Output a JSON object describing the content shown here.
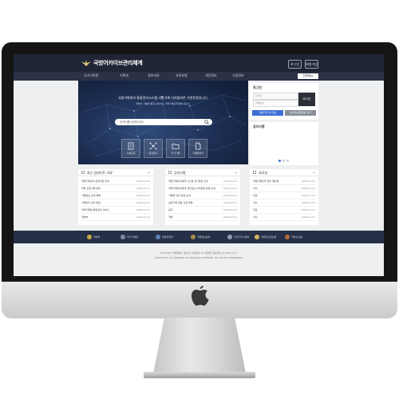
{
  "header": {
    "site_title": "국방어카이브관리체계",
    "buttons": [
      "로그인",
      "회원가입"
    ]
  },
  "nav": {
    "items": [
      "국가기록원",
      "기록관",
      "정보자료",
      "자료유형",
      "개인정보",
      "기관정보"
    ],
    "button_label": "전체메뉴"
  },
  "hero": {
    "headline": "국방기록관리 통합관리시스템 국방기록 디지털보존 기관운영입니다.",
    "subline": "국방부 기록을 통합 관리하는 국방기록관리체계 입니다.",
    "search_placeholder": "검색어를 입력하세요",
    "quick_links": [
      {
        "label": "기록조회",
        "icon": "document-icon"
      },
      {
        "label": "전자문서",
        "icon": "network-icon"
      },
      {
        "label": "국가기록",
        "icon": "folder-icon"
      },
      {
        "label": "기록물관리",
        "icon": "file-icon"
      }
    ]
  },
  "login": {
    "title": "로그인",
    "id_placeholder": "아이디",
    "pw_placeholder": "비밀번호",
    "login_button": "로그인",
    "signup_button": "회원가입 및 인증",
    "find_button": "아이디/비밀번호 찾기"
  },
  "notice": {
    "title": "공지사항"
  },
  "boards": [
    {
      "title": "최근 업데이트 자료",
      "more": "+",
      "rows": [
        {
          "text": "국방기록관리 운영지침 안내",
          "date": "2019.01.01"
        },
        {
          "text": "국방 보존기록 정비",
          "date": "2019.01.01"
        },
        {
          "text": "기록정보 공개 목록",
          "date": "2019.01.01"
        },
        {
          "text": "기록관리 관련 법령",
          "date": "2019.01.01"
        },
        {
          "text": "국방기록원 통합검색 서비스",
          "date": "2019.01.01"
        },
        {
          "text": "국방부",
          "date": "2019.01.01"
        }
      ]
    },
    {
      "title": "공지사항",
      "more": "+",
      "rows": [
        {
          "text": "국방기록관리체계 시스템 정기점검 안내",
          "date": "2019.01.01"
        },
        {
          "text": "국방기록관리체계 개인정보 처리방침 변경 안내",
          "date": "2019.01.01"
        },
        {
          "text": "기록물 이관 일정 안내",
          "date": "2019.01.01"
        },
        {
          "text": "보존기록 열람 신청 방법",
          "date": "2019.01.01"
        },
        {
          "text": "공지",
          "date": "2019.01.01"
        },
        {
          "text": "국방",
          "date": "2019.01.01"
        }
      ]
    },
    {
      "title": "자료실",
      "more": "+",
      "rows": [
        {
          "text": "국방기록관리 업무 매뉴얼",
          "date": "2019.01.01"
        },
        {
          "text": "서식",
          "date": "2019.01.01"
        },
        {
          "text": "자료",
          "date": "2019.01.01"
        },
        {
          "text": "서식",
          "date": "2019.01.01"
        },
        {
          "text": "자료",
          "date": "2019.01.01"
        },
        {
          "text": "서식",
          "date": "2019.01.01"
        }
      ]
    }
  ],
  "footer": {
    "links": [
      "국방부",
      "국가기록원",
      "행정안전부",
      "국방정보본부",
      "국군기무사령부",
      "국방전산정보원",
      "국방홍보원"
    ],
    "address": "우)04383 서울특별시 용산구 이태원로 22 국방부 대표전화 02-748-1111",
    "copyright": "COPYRIGHT (C) MINISTRY OF NATIONAL DEFENSE. ALL RIGHTS RESERVED."
  },
  "colors": {
    "header": "#1f2536",
    "nav": "#2b3246",
    "accent_blue": "#3d6fd6",
    "dark_button": "#2c2f36"
  }
}
